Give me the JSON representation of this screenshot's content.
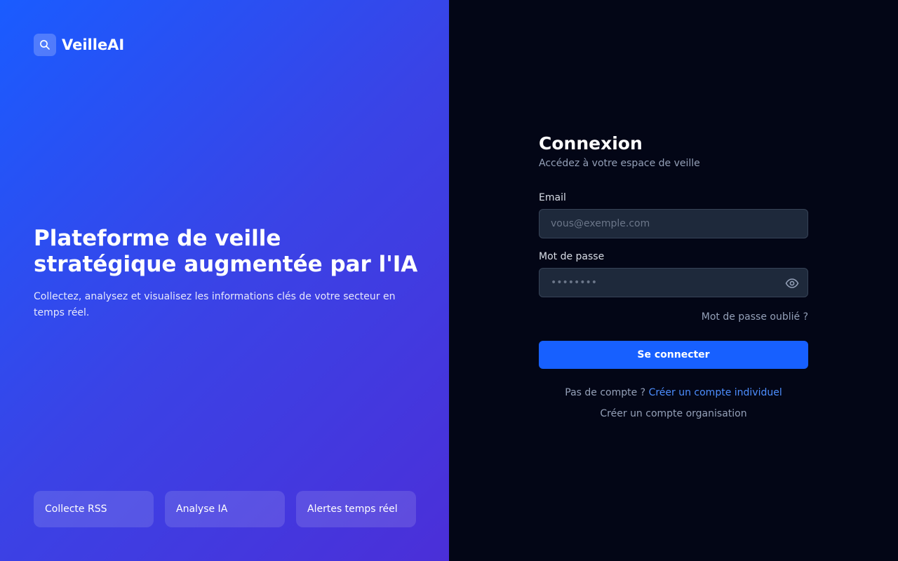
{
  "brand": {
    "name": "VeilleAI",
    "icon": "search-icon"
  },
  "hero": {
    "title": "Plateforme de veille stratégique augmentée par l'IA",
    "subtitle": "Collectez, analysez et visualisez les informations clés de votre secteur en temps réel."
  },
  "features": [
    {
      "label": "Collecte RSS"
    },
    {
      "label": "Analyse IA"
    },
    {
      "label": "Alertes temps réel"
    }
  ],
  "login": {
    "title": "Connexion",
    "subtitle": "Accédez à votre espace de veille",
    "email_label": "Email",
    "email_placeholder": "vous@exemple.com",
    "email_value": "",
    "password_label": "Mot de passe",
    "password_placeholder": "••••••••",
    "password_value": "",
    "forgot_link": "Mot de passe oublié ?",
    "submit_label": "Se connecter",
    "no_account_text": "Pas de compte ?",
    "create_individual_link": "Créer un compte individuel",
    "create_org_link": "Créer un compte organisation"
  },
  "colors": {
    "accent": "#1760ff",
    "link": "#4d8eff",
    "right_bg": "#030616",
    "input_bg": "#1e293b"
  }
}
